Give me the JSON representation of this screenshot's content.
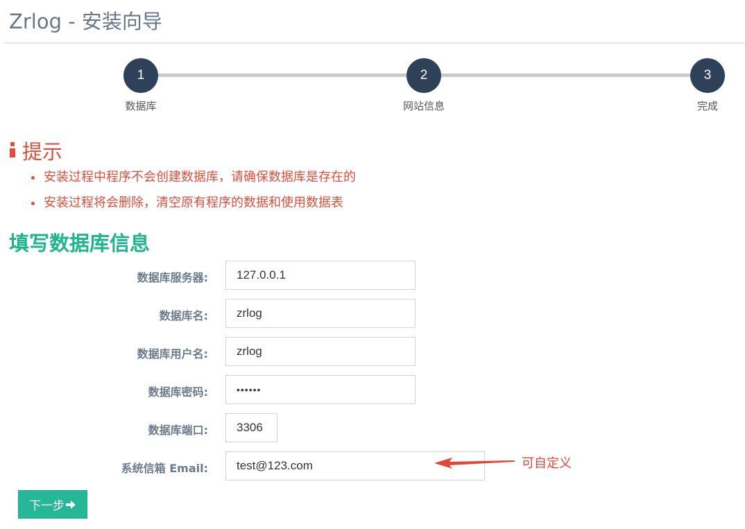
{
  "page": {
    "title": "Zrlog - 安装向导"
  },
  "steps": [
    {
      "number": "1",
      "label": "数据库"
    },
    {
      "number": "2",
      "label": "网站信息"
    },
    {
      "number": "3",
      "label": "完成"
    }
  ],
  "tip": {
    "title": "提示",
    "icon": "info-icon",
    "items": [
      "安装过程中程序不会创建数据库，请确保数据库是存在的",
      "安装过程将会删除，清空原有程序的数据和使用数据表"
    ]
  },
  "form": {
    "title": "填写数据库信息",
    "fields": [
      {
        "label": "数据库服务器:",
        "value": "127.0.0.1"
      },
      {
        "label": "数据库名:",
        "value": "zrlog"
      },
      {
        "label": "数据库用户名:",
        "value": "zrlog"
      },
      {
        "label": "数据库密码:",
        "value": "••••••"
      },
      {
        "label": "数据库端口:",
        "value": "3306"
      },
      {
        "label": "系统信箱 Email:",
        "value": "test@123.com"
      }
    ],
    "next_label": "下一步"
  },
  "annotation": {
    "text": "可自定义"
  },
  "colors": {
    "step_circle": "#2e4158",
    "tip_red": "#de4e3c",
    "section_green": "#1fb48f",
    "button_green": "#26b798",
    "annotation_red": "#e2463a"
  }
}
